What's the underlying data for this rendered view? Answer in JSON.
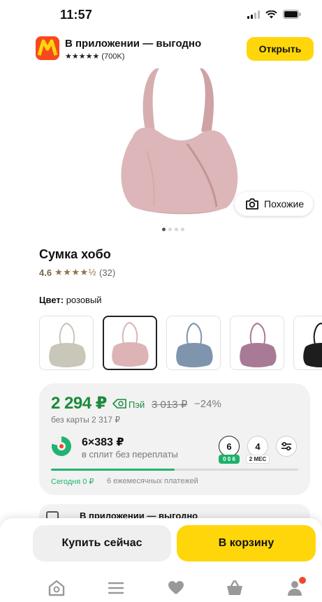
{
  "status_bar": {
    "time": "11:57"
  },
  "app_banner": {
    "title": "В приложении — выгодно",
    "rating": "★★★★★ (700K)",
    "open_label": "Открыть"
  },
  "gallery": {
    "similar_label": "Похожие",
    "current_index": 1,
    "total": 4
  },
  "product": {
    "title": "Сумка хобо",
    "rating_value": "4.6",
    "rating_stars": "★★★★½",
    "review_count": "(32)"
  },
  "color": {
    "label": "Цвет:",
    "value": "розовый",
    "swatches": [
      {
        "name": "beige",
        "color": "#c9c6ba",
        "selected": false
      },
      {
        "name": "pink",
        "color": "#dcb4b6",
        "selected": true
      },
      {
        "name": "blue",
        "color": "#7f94ad",
        "selected": false
      },
      {
        "name": "purple",
        "color": "#a97a96",
        "selected": false
      },
      {
        "name": "black",
        "color": "#1d1d1d",
        "selected": false
      }
    ]
  },
  "price": {
    "current": "2 294 ₽",
    "pay_label": "Пэй",
    "old": "3 013 ₽",
    "discount": "−24%",
    "no_card": "без карты 2 317 ₽"
  },
  "split": {
    "amount": "6×383 ₽",
    "subtitle": "в сплит без переплаты",
    "terms": [
      {
        "months": "6",
        "badge": "0 0 6",
        "selected": true
      },
      {
        "months": "4",
        "badge": "2 МЕС",
        "selected": false
      }
    ],
    "today_label": "Сегодня 0 ₽",
    "payments_label": "6 ежемесячных платежей",
    "progress_fraction": 0.5
  },
  "banner2": {
    "title": "В приложении — выгодно"
  },
  "actions": {
    "buy_now": "Купить сейчас",
    "to_cart": "В корзину"
  },
  "tab_bar": {
    "items": [
      "home-icon",
      "catalog-icon",
      "favorites-icon",
      "cart-icon",
      "profile-icon"
    ]
  },
  "colors": {
    "accent_yellow": "#ffd60a",
    "price_green": "#1b8a3b",
    "split_green": "#21b36f",
    "brand_red": "#f7491d"
  }
}
